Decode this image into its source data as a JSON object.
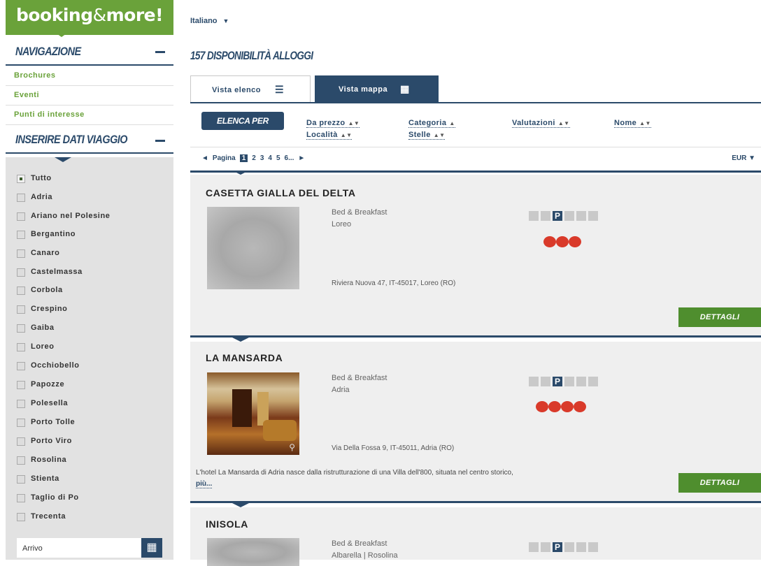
{
  "logo": {
    "brand": "booking",
    "amp": "&",
    "rest": "more!"
  },
  "navigation": {
    "title": "NAVIGAZIONE",
    "items": [
      "Brochures",
      "Eventi",
      "Punti di interesse"
    ]
  },
  "travel": {
    "title": "INSERIRE DATI VIAGGIO"
  },
  "filters": [
    {
      "label": "Tutto",
      "checked": true
    },
    {
      "label": "Adria",
      "checked": false
    },
    {
      "label": "Ariano nel Polesine",
      "checked": false
    },
    {
      "label": "Bergantino",
      "checked": false
    },
    {
      "label": "Canaro",
      "checked": false
    },
    {
      "label": "Castelmassa",
      "checked": false
    },
    {
      "label": "Corbola",
      "checked": false
    },
    {
      "label": "Crespino",
      "checked": false
    },
    {
      "label": "Gaiba",
      "checked": false
    },
    {
      "label": "Loreo",
      "checked": false
    },
    {
      "label": "Occhiobello",
      "checked": false
    },
    {
      "label": "Papozze",
      "checked": false
    },
    {
      "label": "Polesella",
      "checked": false
    },
    {
      "label": "Porto Tolle",
      "checked": false
    },
    {
      "label": "Porto Viro",
      "checked": false
    },
    {
      "label": "Rosolina",
      "checked": false
    },
    {
      "label": "Stienta",
      "checked": false
    },
    {
      "label": "Taglio di Po",
      "checked": false
    },
    {
      "label": "Trecenta",
      "checked": false
    }
  ],
  "arrivo": {
    "label": "Arrivo",
    "icon": "calendar-icon"
  },
  "language": {
    "label": "Italiano",
    "icon": "triangle-down-icon"
  },
  "results": {
    "title": "157 DISPONIBILITÀ ALLOGGI"
  },
  "tabs": {
    "list": {
      "label": "Vista elenco",
      "icon": "list-icon"
    },
    "map": {
      "label": "Vista mappa",
      "icon": "map-icon"
    }
  },
  "sort": {
    "button": "ELENCA PER",
    "options": {
      "price": "Da prezzo",
      "category": "Categoria",
      "ratings": "Valutazioni",
      "name": "Nome",
      "locality": "Località",
      "stars": "Stelle"
    },
    "arrows": {
      "updown": "▲▼",
      "up": "▲"
    }
  },
  "pager": {
    "prev": "◄",
    "label": "Pagina",
    "current": "1",
    "pages": [
      "2",
      "3",
      "4",
      "5",
      "6..."
    ],
    "next": "►",
    "currency": "EUR",
    "currency_arrow": "▼"
  },
  "listings": [
    {
      "title": "CASETTA GIALLA DEL DELTA",
      "type": "Bed & Breakfast",
      "city": "Loreo",
      "address": "Riviera Nuova 47, IT-45017, Loreo (RO)",
      "rating": 3,
      "button": "DETTAGLI"
    },
    {
      "title": "LA MANSARDA",
      "type": "Bed & Breakfast",
      "city": "Adria",
      "address": "Via Della Fossa 9, IT-45011, Adria (RO)",
      "rating": 4,
      "description": "L'hotel La Mansarda di Adria nasce dalla ristrutturazione di una Villa dell'800, situata nel centro storico,",
      "more": "più...",
      "button": "DETTAGLI"
    },
    {
      "title": "INISOLA",
      "type": "Bed & Breakfast",
      "city": "Albarella | Rosolina"
    }
  ],
  "amenity_icons": [
    "tv-icon",
    "minibar-icon",
    "parking-icon",
    "pets-icon",
    "wellness-icon",
    "wheelchair-icon"
  ],
  "amenity_parking_letter": "P",
  "colors": {
    "accent_green": "#6aa23a",
    "navy": "#2b4a6a",
    "rating_red": "#d93a2a",
    "button_green": "#4f8e2e"
  }
}
